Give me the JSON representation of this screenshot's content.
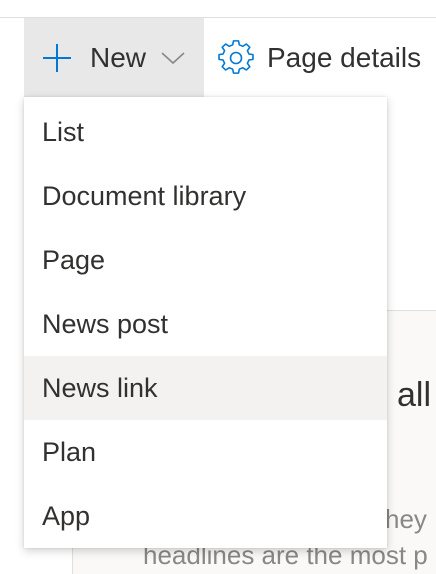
{
  "toolbar": {
    "new_label": "New",
    "new_icon": "plus-icon",
    "new_chevron_icon": "chevron-down-icon",
    "page_details_label": "Page details",
    "page_details_icon": "gear-icon",
    "accent_color": "#0078d4"
  },
  "menu": {
    "items": [
      {
        "label": "List"
      },
      {
        "label": "Document library"
      },
      {
        "label": "Page"
      },
      {
        "label": "News post"
      },
      {
        "label": "News link",
        "hovered": true
      },
      {
        "label": "Plan"
      },
      {
        "label": "App"
      }
    ]
  },
  "background": {
    "heading_fragment": "all",
    "text_fragment_1": "hey",
    "text_fragment_2": "headlines are the most p"
  }
}
